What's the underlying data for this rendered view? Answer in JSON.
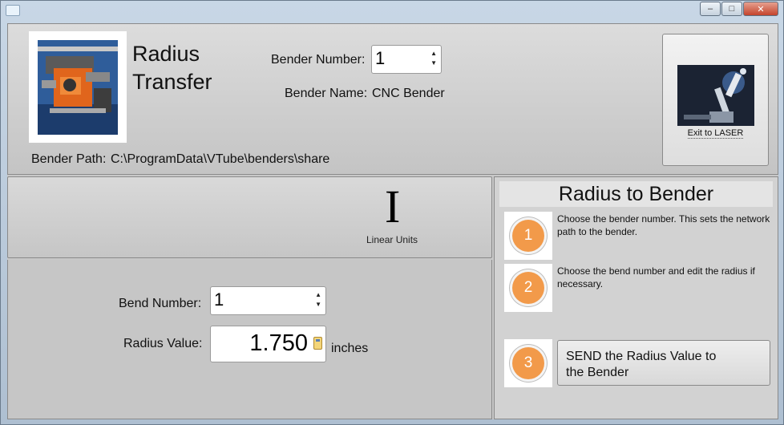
{
  "app": {
    "title_line1": "Radius",
    "title_line2": "Transfer"
  },
  "bender": {
    "number_label": "Bender Number:",
    "number_value": "1",
    "name_label": "Bender Name:",
    "name_value": "CNC Bender",
    "path_label": "Bender Path:",
    "path_value": "C:\\ProgramData\\VTube\\benders\\share"
  },
  "exit_button": {
    "label": "Exit to LASER"
  },
  "units": {
    "icon_glyph": "I",
    "label": "Linear Units"
  },
  "bend": {
    "number_label": "Bend Number:",
    "number_value": "1",
    "radius_label": "Radius Value:",
    "radius_value": "1.750",
    "radius_unit": "inches"
  },
  "steps": {
    "header": "Radius to Bender",
    "items": [
      {
        "number": "1",
        "text": "Choose the bender number.  This sets the network path to the bender."
      },
      {
        "number": "2",
        "text": "Choose the bend number and edit the radius if necessary."
      },
      {
        "number": "3",
        "text": "SEND the Radius Value to the Bender"
      }
    ]
  },
  "window_controls": {
    "minimize": "–",
    "maximize": "□",
    "close": "✕"
  },
  "colors": {
    "step_orange": "#f29a4a",
    "panel_gray": "#c6c6c6"
  }
}
